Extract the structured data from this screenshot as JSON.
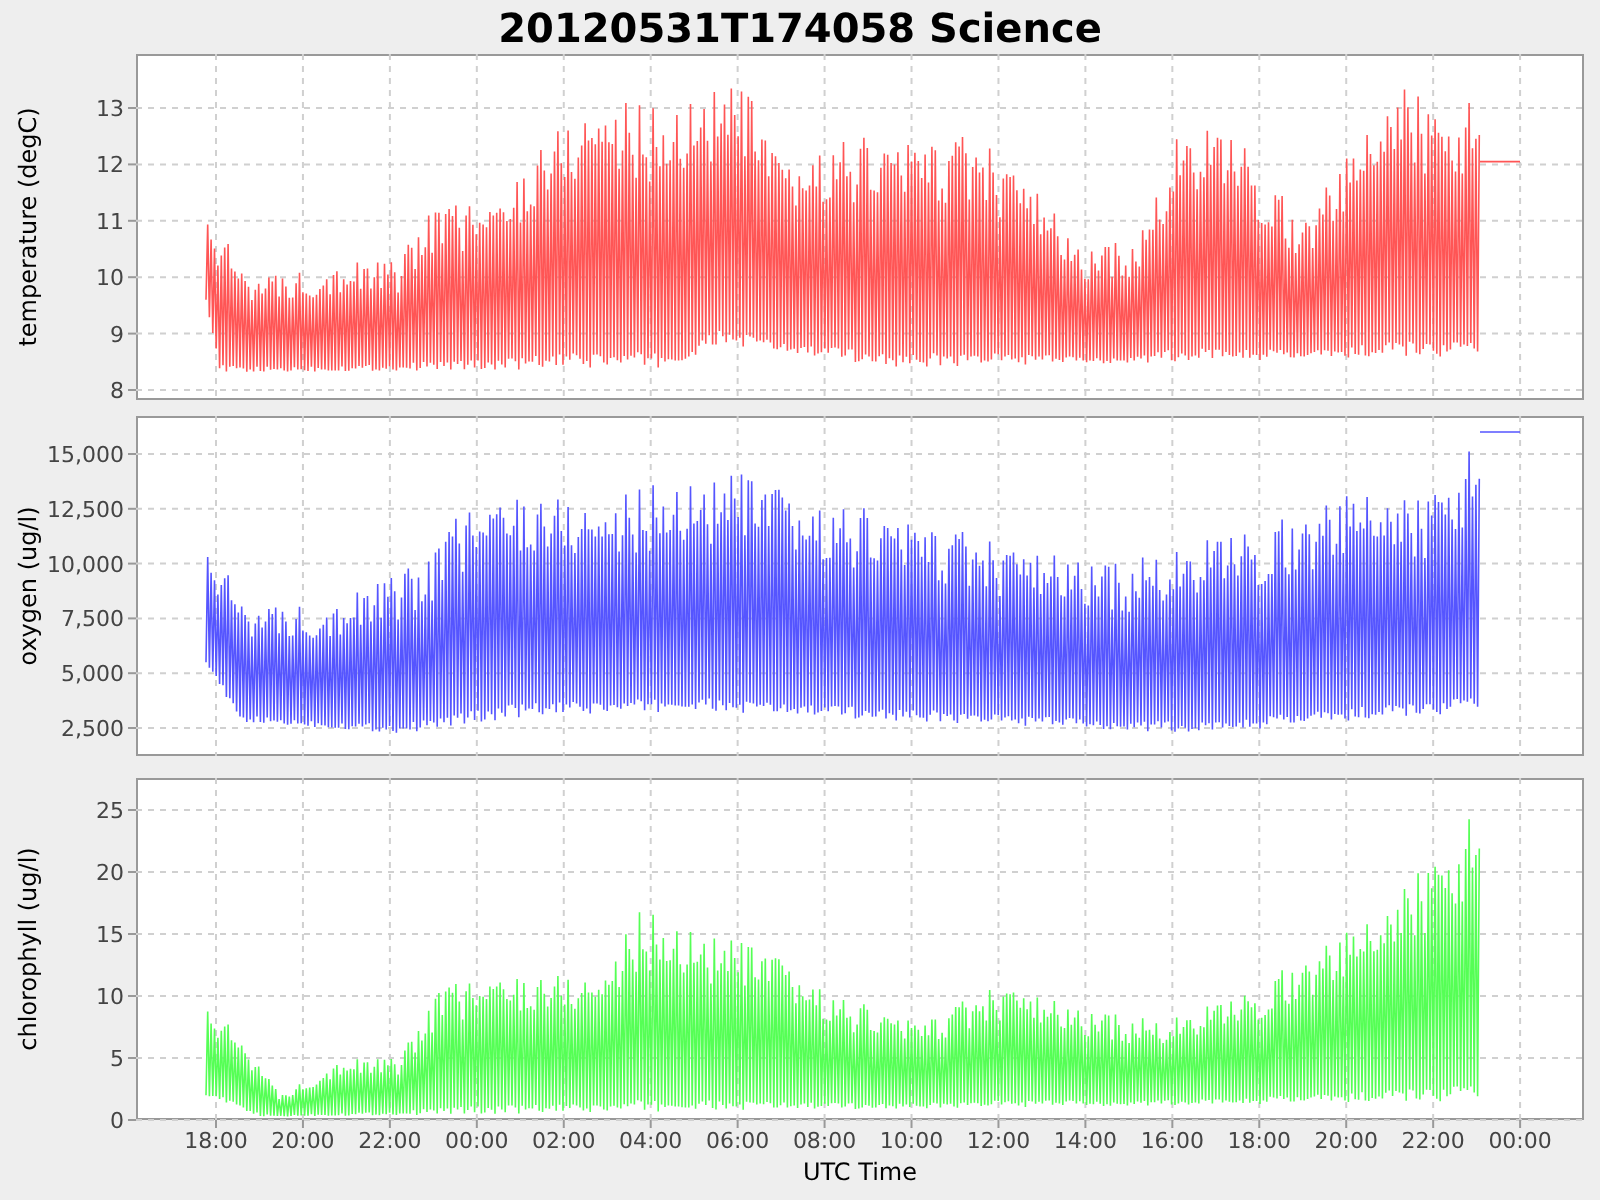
{
  "title": "20120531T174058 Science",
  "panels": [
    {
      "kind": "temperature",
      "ylabel": "temperature (degC)",
      "color": "#ff5555",
      "yticks": [
        "13",
        "12",
        "11",
        "10",
        "9",
        "8"
      ]
    },
    {
      "kind": "oxygen",
      "ylabel": "oxygen (ug/l)",
      "color": "#5555ff",
      "yticks": [
        "15,000",
        "12,500",
        "10,000",
        "7,500",
        "5,000",
        "2,500"
      ]
    },
    {
      "kind": "chlorophyll",
      "ylabel": "chlorophyll (ug/l)",
      "color": "#55ff55",
      "yticks": [
        "25",
        "20",
        "15",
        "10",
        "5",
        "0"
      ]
    }
  ],
  "x_axis": {
    "label": "UTC Time",
    "ticks": [
      "18:00",
      "20:00",
      "22:00",
      "00:00",
      "02:00",
      "04:00",
      "06:00",
      "08:00",
      "10:00",
      "12:00",
      "14:00",
      "16:00",
      "18:00",
      "20:00",
      "22:00",
      "00:00"
    ]
  }
}
